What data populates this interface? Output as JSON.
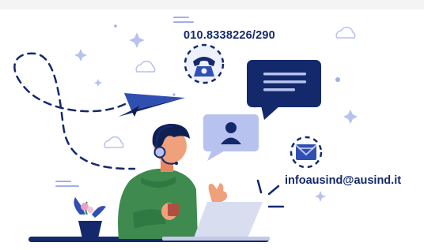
{
  "contact": {
    "phone": "010.8338226/290",
    "email": "infoausind@ausind.it"
  },
  "colors": {
    "navy": "#14296b",
    "blue": "#2f4fb3",
    "light_blue": "#b7c2ef",
    "green": "#3e8a4f",
    "skin": "#e98660"
  }
}
